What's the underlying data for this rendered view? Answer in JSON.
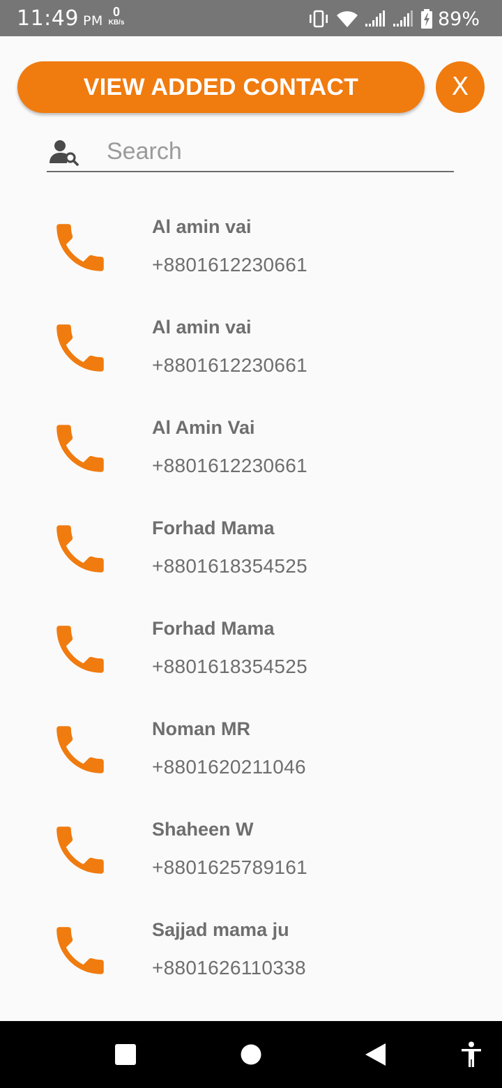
{
  "status_bar": {
    "time": "11:49",
    "ampm": "PM",
    "speed_value": "0",
    "speed_unit": "KB/s",
    "battery": "89%"
  },
  "header": {
    "view_button_label": "VIEW ADDED CONTACT",
    "close_button_label": "X"
  },
  "search": {
    "placeholder": "Search",
    "value": ""
  },
  "contacts": [
    {
      "name": "Al amin vai",
      "phone": "+8801612230661"
    },
    {
      "name": "Al amin vai",
      "phone": "+8801612230661"
    },
    {
      "name": "Al Amin Vai",
      "phone": "+8801612230661"
    },
    {
      "name": "Forhad Mama",
      "phone": "+8801618354525"
    },
    {
      "name": "Forhad Mama",
      "phone": "+8801618354525"
    },
    {
      "name": "Noman MR",
      "phone": "+8801620211046"
    },
    {
      "name": "Shaheen W",
      "phone": "+8801625789161"
    },
    {
      "name": "Sajjad mama ju",
      "phone": "+8801626110338"
    }
  ],
  "colors": {
    "accent": "#f07b0f",
    "status_bar": "#767676",
    "nav_bar": "#000000",
    "text": "#6e6e6e"
  },
  "icons": {
    "contact_row": "phone-icon",
    "search": "contact-search-icon",
    "nav": [
      "recents-square-icon",
      "home-circle-icon",
      "back-triangle-icon",
      "accessibility-icon"
    ]
  }
}
